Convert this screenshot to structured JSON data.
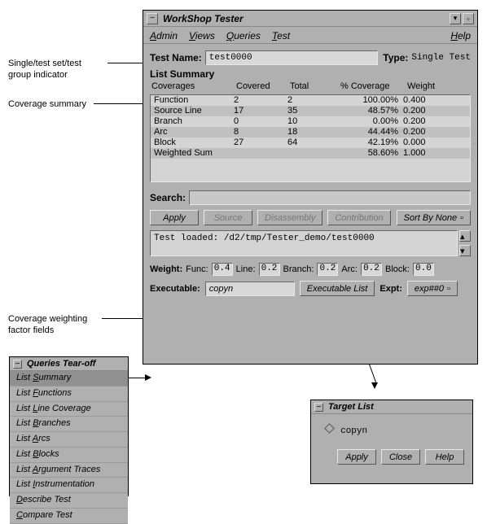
{
  "annotations": {
    "a1": "Single/test set/test\ngroup indicator",
    "a2": "Coverage summary",
    "a3": "Coverage weighting\nfactor fields"
  },
  "main_window": {
    "title": "WorkShop Tester",
    "menus": {
      "admin": "Admin",
      "views": "Views",
      "queries": "Queries",
      "test": "Test",
      "help": "Help"
    },
    "test_name_label": "Test Name:",
    "test_name_value": "test0000",
    "type_label": "Type:",
    "type_value": "Single Test",
    "list_summary_title": "List Summary",
    "headers": {
      "c0": "Coverages",
      "c1": "Covered",
      "c2": "Total",
      "c3": "% Coverage",
      "c4": "Weight"
    },
    "rows": [
      {
        "c0": "Function",
        "c1": "2",
        "c2": "2",
        "c3": "100.00%",
        "c4": "0.400"
      },
      {
        "c0": "Source Line",
        "c1": "17",
        "c2": "35",
        "c3": "48.57%",
        "c4": "0.200"
      },
      {
        "c0": "Branch",
        "c1": "0",
        "c2": "10",
        "c3": "0.00%",
        "c4": "0.200"
      },
      {
        "c0": "Arc",
        "c1": "8",
        "c2": "18",
        "c3": "44.44%",
        "c4": "0.200"
      },
      {
        "c0": "Block",
        "c1": "27",
        "c2": "64",
        "c3": "42.19%",
        "c4": "0.000"
      },
      {
        "c0": "Weighted Sum",
        "c1": "",
        "c2": "",
        "c3": "58.60%",
        "c4": "1.000"
      }
    ],
    "search_label": "Search:",
    "buttons": {
      "apply": "Apply",
      "source": "Source",
      "disassembly": "Disassembly",
      "contribution": "Contribution",
      "sort": "Sort By None"
    },
    "message": "Test loaded: /d2/tmp/Tester_demo/test0000",
    "weights": {
      "label": "Weight:",
      "func_lbl": "Func:",
      "func": "0.4",
      "line_lbl": "Line:",
      "line": "0.2",
      "branch_lbl": "Branch:",
      "branch": "0.2",
      "arc_lbl": "Arc:",
      "arc": "0.2",
      "block_lbl": "Block:",
      "block": "0.0"
    },
    "executable_label": "Executable:",
    "executable_value": "copyn",
    "executable_list_btn": "Executable List",
    "expt_label": "Expt:",
    "expt_value": "exp##0"
  },
  "tearoff": {
    "title": "Queries Tear-off",
    "items": [
      "List Summary",
      "List Functions",
      "List Line Coverage",
      "List Branches",
      "List Arcs",
      "List Blocks",
      "List Argument Traces",
      "List Instrumentation",
      "Describe Test",
      "Compare Test"
    ],
    "selected_index": 0
  },
  "target": {
    "title": "Target List",
    "item": "copyn",
    "buttons": {
      "apply": "Apply",
      "close": "Close",
      "help": "Help"
    }
  }
}
